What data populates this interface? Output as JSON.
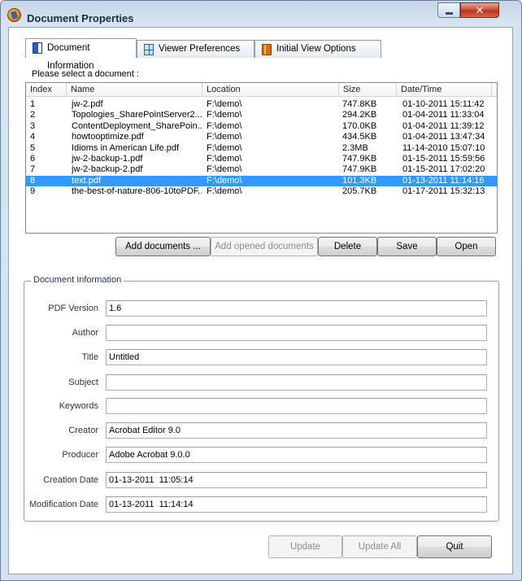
{
  "window": {
    "title": "Document Properties",
    "close_glyph": "✕"
  },
  "tabs": [
    {
      "label": "Document Information",
      "icon": "document-icon",
      "active": true
    },
    {
      "label": "Viewer Preferences",
      "icon": "grid-icon",
      "active": false
    },
    {
      "label": "Initial View Options",
      "icon": "book-icon",
      "active": false
    }
  ],
  "select_label": "Please select a document :",
  "list": {
    "columns": [
      "Index",
      "Name",
      "Location",
      "Size",
      "Date/Time"
    ],
    "rows": [
      {
        "index": "1",
        "name": "jw-2.pdf",
        "location": "F:\\demo\\",
        "size": "747.8KB",
        "date": "01-10-2011  15:11:42"
      },
      {
        "index": "2",
        "name": "Topologies_SharePointServer2...",
        "location": "F:\\demo\\",
        "size": "294.2KB",
        "date": "01-04-2011  11:33:04"
      },
      {
        "index": "3",
        "name": "ContentDeployment_SharePoin...",
        "location": "F:\\demo\\",
        "size": "170.0KB",
        "date": "01-04-2011  11:39:12"
      },
      {
        "index": "4",
        "name": "howtooptimize.pdf",
        "location": "F:\\demo\\",
        "size": "434.5KB",
        "date": "01-04-2011  13:47:34"
      },
      {
        "index": "5",
        "name": "Idioms in American Life.pdf",
        "location": "F:\\demo\\",
        "size": "2.3MB",
        "date": "11-14-2010  15:07:10"
      },
      {
        "index": "6",
        "name": "jw-2-backup-1.pdf",
        "location": "F:\\demo\\",
        "size": "747.9KB",
        "date": "01-15-2011  15:59:56"
      },
      {
        "index": "7",
        "name": "jw-2-backup-2.pdf",
        "location": "F:\\demo\\",
        "size": "747.9KB",
        "date": "01-15-2011  17:02:20"
      },
      {
        "index": "8",
        "name": "text.pdf",
        "location": "F:\\demo\\",
        "size": "101.3KB",
        "date": "01-13-2011  11:14:16",
        "selected": true
      },
      {
        "index": "9",
        "name": "the-best-of-nature-806-10toPDF...",
        "location": "F:\\demo\\",
        "size": "205.7KB",
        "date": "01-17-2011  15:32:13"
      }
    ]
  },
  "list_buttons": {
    "add_documents": "Add documents ...",
    "add_opened": "Add opened documents",
    "delete": "Delete",
    "save": "Save",
    "open": "Open"
  },
  "doc_info": {
    "group_title": "Document Information",
    "fields": [
      {
        "label": "PDF Version",
        "value": "1.6"
      },
      {
        "label": "Author",
        "value": ""
      },
      {
        "label": "Title",
        "value": "Untitled"
      },
      {
        "label": "Subject",
        "value": ""
      },
      {
        "label": "Keywords",
        "value": ""
      },
      {
        "label": "Creator",
        "value": "Acrobat Editor 9.0"
      },
      {
        "label": "Producer",
        "value": "Adobe Acrobat 9.0.0"
      },
      {
        "label": "Creation Date",
        "value": "01-13-2011  11:05:14"
      },
      {
        "label": "Modification Date",
        "value": "01-13-2011  11:14:14"
      }
    ]
  },
  "bottom_buttons": {
    "update": "Update",
    "update_all": "Update All",
    "quit": "Quit"
  },
  "colors": {
    "selection": "#3399ff",
    "accent": "#1e3454"
  }
}
